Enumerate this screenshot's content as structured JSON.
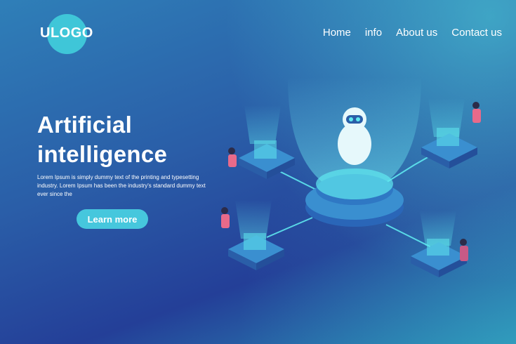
{
  "brand": {
    "logo_text": "ULOGO"
  },
  "nav": {
    "items": [
      "Home",
      "info",
      "About us",
      "Contact us"
    ]
  },
  "hero": {
    "title_line1": "Artificial",
    "title_line2": "intelligence",
    "text": "Lorem Ipsum is simply dummy text of the printing and typesetting industry. Lorem Ipsum has been the industry's standard dummy text ever since the",
    "cta_label": "Learn more"
  },
  "colors": {
    "accent": "#46c7dd",
    "glow": "#5fe8ef",
    "bg_dark": "#243f98",
    "bg_light": "#2f7fb8"
  }
}
